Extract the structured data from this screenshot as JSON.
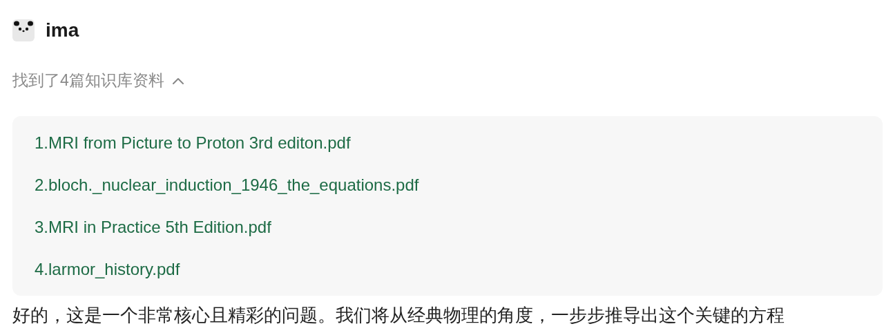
{
  "app": {
    "name": "ima"
  },
  "sources": {
    "summary": "找到了4篇知识库资料",
    "expanded": true,
    "files": [
      {
        "title": "1.MRI from Picture to Proton 3rd editon.pdf"
      },
      {
        "title": "2.bloch._nuclear_induction_1946_the_equations.pdf"
      },
      {
        "title": "3.MRI in Practice 5th Edition.pdf"
      },
      {
        "title": "4.larmor_history.pdf"
      }
    ]
  },
  "answer": "好的，这是一个非常核心且精彩的问题。我们将从经典物理的角度，一步步推导出这个关键的方程"
}
